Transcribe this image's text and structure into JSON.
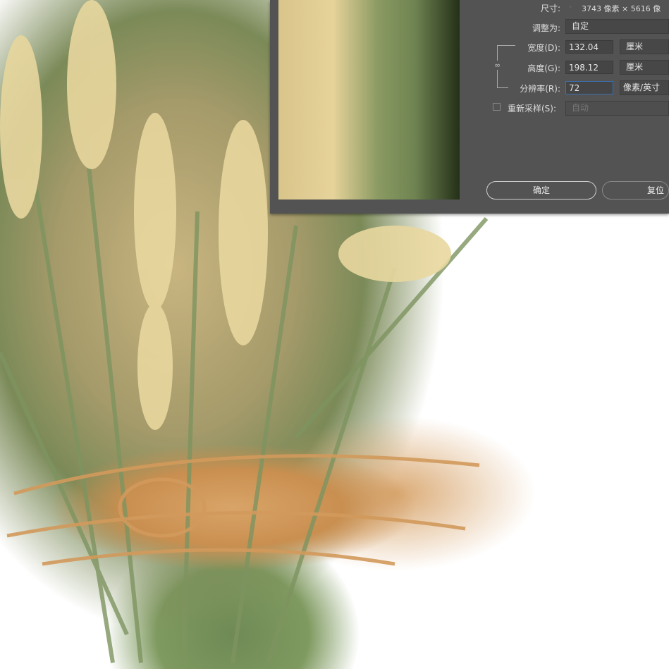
{
  "dialog": {
    "size_label": "尺寸:",
    "size_value": "3743 像素 × 5616 像",
    "fit_label": "调整为:",
    "fit_value": "自定",
    "width_label": "宽度(D):",
    "width_value": "132.04",
    "width_unit": "厘米",
    "height_label": "高度(G):",
    "height_value": "198.12",
    "height_unit": "厘米",
    "res_label": "分辨率(R):",
    "res_value": "72",
    "res_unit": "像素/英寸",
    "resample_label": "重新采样(S):",
    "resample_value": "自动",
    "resample_checked": false,
    "ok_label": "确定",
    "reset_label": "复位"
  }
}
